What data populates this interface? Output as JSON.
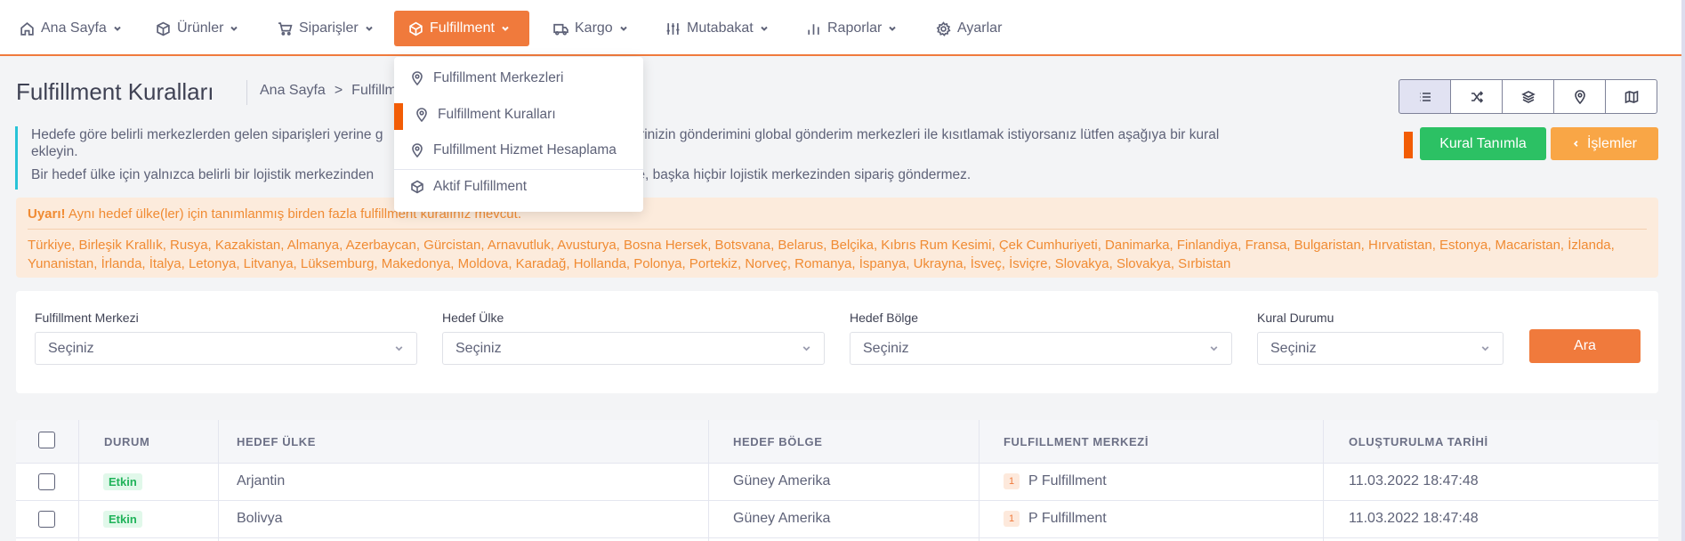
{
  "nav": {
    "items": [
      {
        "label": "Ana Sayfa",
        "icon": "home-icon"
      },
      {
        "label": "Ürünler",
        "icon": "box-icon"
      },
      {
        "label": "Siparişler",
        "icon": "cart-icon"
      },
      {
        "label": "Fulfillment",
        "icon": "cube-icon",
        "active": true
      },
      {
        "label": "Kargo",
        "icon": "truck-icon"
      },
      {
        "label": "Mutabakat",
        "icon": "sliders-icon"
      },
      {
        "label": "Raporlar",
        "icon": "bar-chart-icon"
      },
      {
        "label": "Ayarlar",
        "icon": "gear-icon"
      }
    ]
  },
  "dropdown": {
    "items": [
      {
        "label": "Fulfillment Merkezleri",
        "icon": "location-pin-icon"
      },
      {
        "label": "Fulfillment Kuralları",
        "icon": "location-pin-icon"
      },
      {
        "label": "Fulfillment Hizmet Hesaplama",
        "icon": "location-pin-icon"
      },
      {
        "label": "Aktif Fulfillment",
        "icon": "cube-icon"
      }
    ]
  },
  "page": {
    "title": "Fulfillment Kuralları",
    "breadcrumb": [
      "Ana Sayfa",
      ">",
      "Fulfillm"
    ]
  },
  "info": {
    "line1a": "Hedefe göre belirli merkezlerden gelen siparişleri yerine g",
    "line1b": "erinizin gönderimini global gönderim merkezleri ile kısıtlamak istiyorsanız lütfen aşağıya bir kural ekleyin.",
    "line2a": "Bir hedef ülke için yalnızca belirli bir lojistik merkezinden",
    "line2b": "irse, başka hiçbir lojistik merkezinden sipariş göndermez."
  },
  "warning": {
    "bold": "Uyarı!",
    "text": "Aynı hedef ülke(ler) için tanımlanmış birden fazla fulfillment kuralınız mevcut.",
    "countries": "Türkiye, Birleşik Krallık, Rusya, Kazakistan, Almanya, Azerbaycan, Gürcistan, Arnavutluk, Avusturya, Bosna Hersek, Botsvana, Belarus, Belçika, Kıbrıs Rum Kesimi, Çek Cumhuriyeti, Danimarka, Finlandiya, Fransa, Bulgaristan, Hırvatistan, Estonya, Macaristan, İzlanda, Yunanistan, İrlanda, İtalya, Letonya, Litvanya, Lüksemburg, Makedonya, Moldova, Karadağ, Hollanda, Polonya, Portekiz, Norveç, Romanya, İspanya, Ukrayna, İsveç, İsviçre, Slovakya, Slovakya, Sırbistan"
  },
  "actions": {
    "view_icons": [
      "list-icon",
      "shuffle-icon",
      "layers-icon",
      "location-pin-icon",
      "map-icon"
    ],
    "add_rule": "Kural Tanımla",
    "operations": "İşlemler"
  },
  "filters": {
    "fields": [
      {
        "label": "Fulfillment Merkezi",
        "value": "Seçiniz"
      },
      {
        "label": "Hedef Ülke",
        "value": "Seçiniz"
      },
      {
        "label": "Hedef Bölge",
        "value": "Seçiniz"
      },
      {
        "label": "Kural Durumu",
        "value": "Seçiniz"
      }
    ],
    "search": "Ara"
  },
  "table": {
    "headers": [
      "DURUM",
      "HEDEF ÜLKE",
      "HEDEF BÖLGE",
      "FULFILLMENT MERKEZİ",
      "OLUŞTURULMA TARİHİ"
    ],
    "rows": [
      {
        "status": "Etkin",
        "country": "Arjantin",
        "region": "Güney Amerika",
        "center_count": "1",
        "center": "P Fulfillment",
        "date": "11.03.2022 18:47:48"
      },
      {
        "status": "Etkin",
        "country": "Bolivya",
        "region": "Güney Amerika",
        "center_count": "1",
        "center": "P Fulfillment",
        "date": "11.03.2022 18:47:48"
      }
    ]
  },
  "colors": {
    "accent": "#f07a3c",
    "success": "#2cc164",
    "warning": "#f9a646",
    "info_border": "#28c3d7"
  }
}
